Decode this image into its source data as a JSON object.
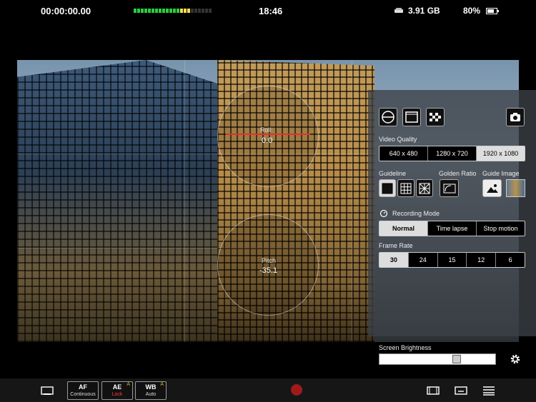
{
  "status": {
    "timecode": "00:00:00.00",
    "clock": "18:46",
    "storage": "3.91 GB",
    "battery": "80%",
    "audio_level": 0.72,
    "colors": {
      "meter_green": "#2ecc40",
      "meter_yellow": "#f4e04d",
      "meter_red": "#e03232"
    }
  },
  "viewfinder": {
    "roll_label": "Roll",
    "roll_value": "0.0",
    "pitch_label": "Pitch",
    "pitch_value": "-35.1"
  },
  "panel": {
    "video_quality_label": "Video Quality",
    "video_quality_options": [
      "640 x 480",
      "1280 x 720",
      "1920 x 1080"
    ],
    "video_quality_selected": "1920 x 1080",
    "guideline_label": "Guideline",
    "golden_ratio_label": "Golden Ratio",
    "guide_image_label": "Guide Image",
    "recording_mode_label": "Recording Mode",
    "recording_mode_options": [
      "Normal",
      "Time lapse",
      "Stop motion"
    ],
    "recording_mode_selected": "Normal",
    "frame_rate_label": "Frame Rate",
    "frame_rate_options": [
      "30",
      "24",
      "15",
      "12",
      "6"
    ],
    "frame_rate_selected": "30"
  },
  "brightness": {
    "label": "Screen Brightness",
    "level": 0.68
  },
  "toolbar": {
    "af_title": "AF",
    "af_sub": "Continuous",
    "ae_title": "AE",
    "ae_sub": "Lock",
    "wb_title": "WB",
    "wb_sub": "Auto",
    "warn_glyph": "A",
    "record_color": "#a01a1a"
  }
}
